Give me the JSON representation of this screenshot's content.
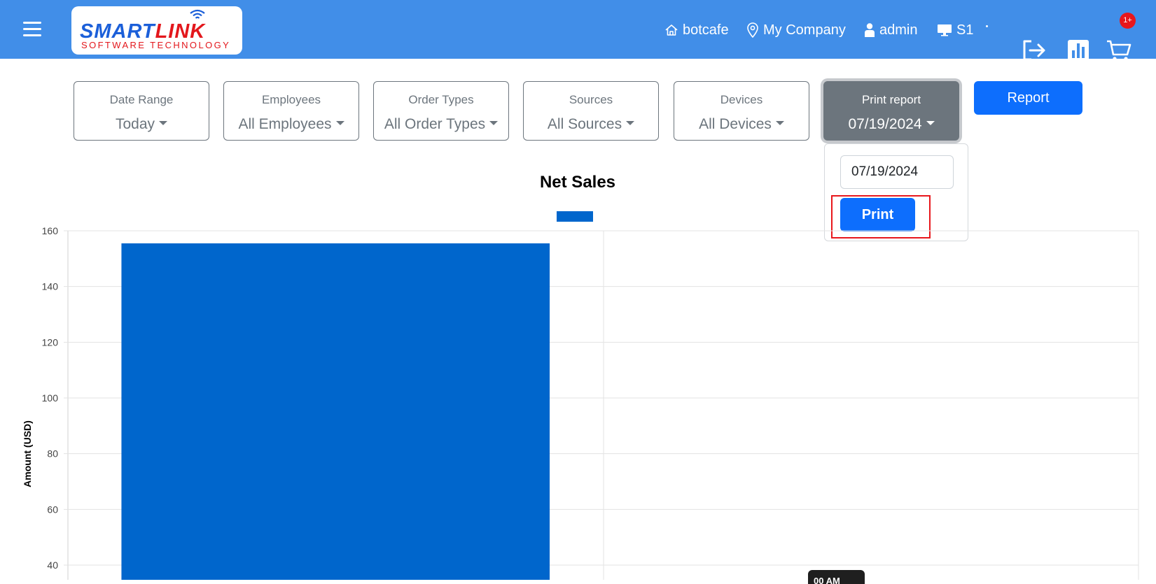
{
  "header": {
    "logo_main_blue": "SMART",
    "logo_main_red": "LINK",
    "logo_sub": "SOFTWARE TECHNOLOGY",
    "store": "botcafe",
    "company": "My Company",
    "user": "admin",
    "station": "S1",
    "cart_badge": "1+"
  },
  "filters": [
    {
      "label": "Date Range",
      "value": "Today"
    },
    {
      "label": "Employees",
      "value": "All Employees"
    },
    {
      "label": "Order Types",
      "value": "All Order Types"
    },
    {
      "label": "Sources",
      "value": "All Sources"
    },
    {
      "label": "Devices",
      "value": "All Devices"
    },
    {
      "label": "Print report",
      "value": "07/19/2024"
    }
  ],
  "report_button": "Report",
  "print_dropdown": {
    "date_value": "07/19/2024",
    "print_label": "Print"
  },
  "tooltip_text": "00 AM",
  "colors": {
    "topbar": "#418ee8",
    "primary": "#0d6efd",
    "bar": "#0066cc",
    "highlight": "#e8171c"
  },
  "chart_data": {
    "type": "bar",
    "title": "Net Sales",
    "ylabel": "Amount (USD)",
    "xlabel": "",
    "series": [
      {
        "values": [
          155.5,
          0
        ]
      }
    ],
    "yticks": [
      40,
      60,
      80,
      100,
      120,
      140,
      160
    ],
    "ylim": [
      0,
      160
    ],
    "grid": true,
    "legend": "top-center"
  }
}
